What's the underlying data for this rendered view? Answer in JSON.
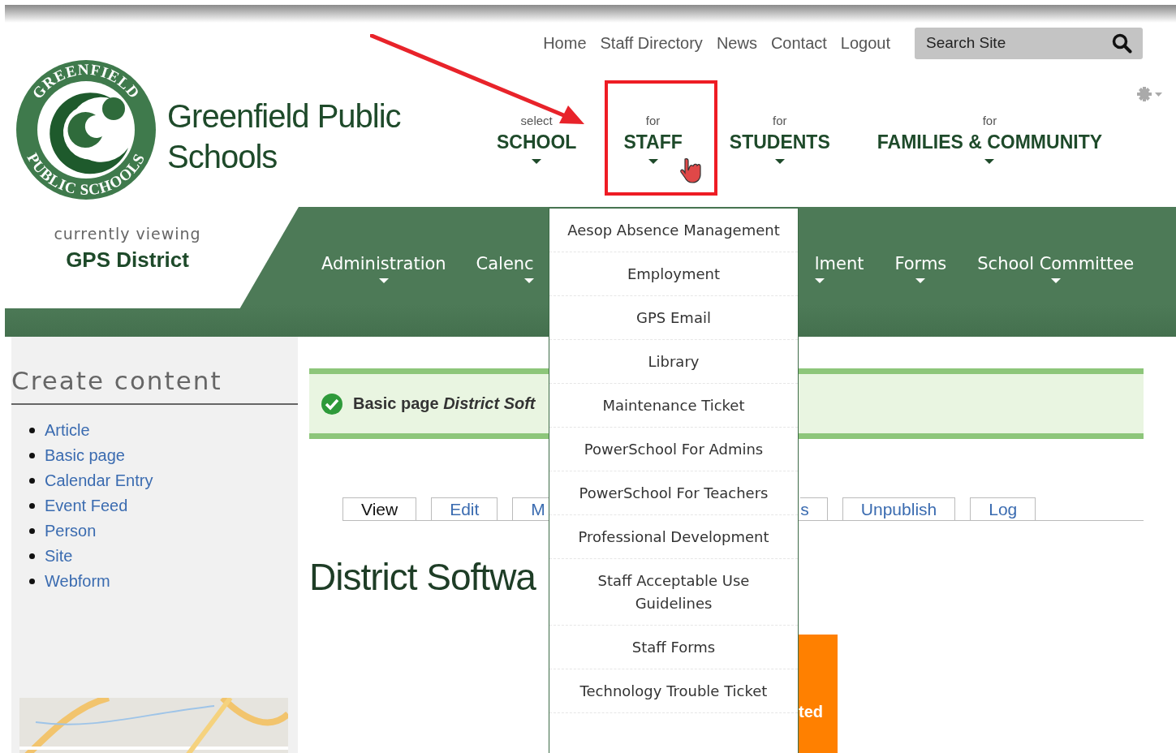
{
  "logo": {
    "top_text": "GREENFIELD",
    "bottom_text": "PUBLIC SCHOOLS"
  },
  "site_title": "Greenfield Public Schools",
  "top_links": [
    "Home",
    "Staff Directory",
    "News",
    "Contact",
    "Logout"
  ],
  "search": {
    "placeholder": "Search Site"
  },
  "audience_nav": [
    {
      "small": "select",
      "label": "SCHOOL"
    },
    {
      "small": "for",
      "label": "STAFF"
    },
    {
      "small": "for",
      "label": "STUDENTS"
    },
    {
      "small": "for",
      "label": "FAMILIES & COMMUNITY"
    }
  ],
  "viewing": {
    "caption": "currently viewing",
    "site": "GPS District"
  },
  "main_nav": [
    {
      "label": "Administration",
      "kind": "full"
    },
    {
      "label": "Calenc",
      "kind": "cut_right"
    },
    {
      "label": "lment",
      "kind": "cut_left"
    },
    {
      "label": "Forms",
      "kind": "full"
    },
    {
      "label": "School Committee",
      "kind": "full"
    }
  ],
  "sidebar": {
    "title": "Create content",
    "items": [
      "Article",
      "Basic page",
      "Calendar Entry",
      "Event Feed",
      "Person",
      "Site",
      "Webform"
    ]
  },
  "message": "Basic page *District Soft*",
  "tabs": [
    {
      "label": "View",
      "selected": true,
      "kind": "full"
    },
    {
      "label": "Edit",
      "selected": false,
      "kind": "full"
    },
    {
      "label": "M",
      "selected": false,
      "kind": "cut_right"
    },
    {
      "label": "s",
      "selected": false,
      "kind": "cut_left"
    },
    {
      "label": "Unpublish",
      "selected": false,
      "kind": "full"
    },
    {
      "label": "Log",
      "selected": false,
      "kind": "full"
    }
  ],
  "page_title": "District Softwa",
  "orange_block_text": "ted",
  "dropdown": [
    "Aesop Absence Management",
    "Employment",
    "GPS Email",
    "Library",
    "Maintenance Ticket",
    "PowerSchool For Admins",
    "PowerSchool For Teachers",
    "Professional Development",
    "Staff Acceptable Use Guidelines",
    "Staff Forms",
    "Technology Trouble Ticket"
  ]
}
